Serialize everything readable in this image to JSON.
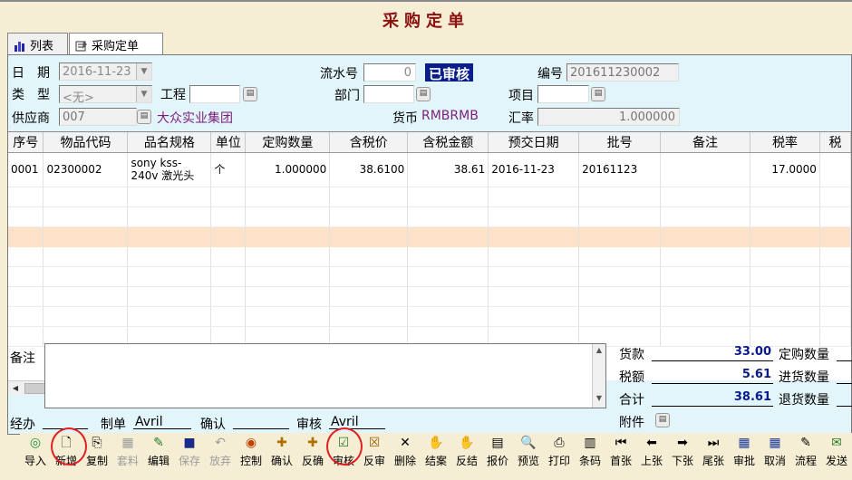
{
  "window": {
    "title": "采购定单"
  },
  "tabs": [
    {
      "label": "列表",
      "icon": "chart-icon"
    },
    {
      "label": "采购定单",
      "icon": "form-icon"
    }
  ],
  "header": {
    "date_label": "日　期",
    "date_value": "2016-11-23",
    "serial_label": "流水号",
    "serial_value": "0",
    "status": "已审核",
    "number_label": "编号",
    "number_value": "201611230002",
    "type_label": "类　型",
    "type_value": "<无>",
    "project_label": "工程",
    "project_value": "",
    "dept_label": "部门",
    "dept_value": "",
    "item_label": "项目",
    "item_value": "",
    "supplier_label": "供应商",
    "supplier_code": "007",
    "supplier_name": "大众实业集团",
    "currency_label": "货币",
    "currency_value": "RMBRMB",
    "rate_label": "汇率",
    "rate_value": "1.000000"
  },
  "grid": {
    "columns": [
      "序号",
      "物品代码",
      "品名规格",
      "单位",
      "定购数量",
      "含税价",
      "含税金额",
      "预交日期",
      "批号",
      "备注",
      "税率",
      "税"
    ],
    "rows": [
      [
        "0001",
        "02300002",
        "sony kss-240v 激光头",
        "个",
        "1.000000",
        "38.6100",
        "38.61",
        "2016-11-23",
        "20161123",
        "",
        "17.0000",
        ""
      ]
    ]
  },
  "notes": {
    "label": "备注",
    "value": ""
  },
  "summary": {
    "goods_label": "货款",
    "goods_value": "33.00",
    "tax_label": "税额",
    "tax_value": "5.61",
    "total_label": "合计",
    "total_value": "38.61",
    "attach_label": "附件",
    "order_qty_label": "定购数量",
    "in_qty_label": "进货数量",
    "return_qty_label": "退货数量"
  },
  "footer": {
    "handler_label": "经办",
    "handler_value": "",
    "maker_label": "制单",
    "maker_value": "Avril",
    "confirm_label": "确认",
    "confirm_value": "",
    "auditor_label": "审核",
    "auditor_value": "Avril"
  },
  "toolbar": [
    {
      "label": "导入",
      "icon": "import-icon",
      "enabled": true
    },
    {
      "label": "新增",
      "icon": "new-document-icon",
      "enabled": true
    },
    {
      "label": "复制",
      "icon": "copy-icon",
      "enabled": true
    },
    {
      "label": "套料",
      "icon": "material-icon",
      "enabled": false
    },
    {
      "label": "编辑",
      "icon": "edit-icon",
      "enabled": true
    },
    {
      "label": "保存",
      "icon": "save-icon",
      "enabled": false
    },
    {
      "label": "放弃",
      "icon": "undo-icon",
      "enabled": false
    },
    {
      "label": "控制",
      "icon": "control-icon",
      "enabled": true
    },
    {
      "label": "确认",
      "icon": "confirm-icon",
      "enabled": true
    },
    {
      "label": "反确",
      "icon": "unconfirm-icon",
      "enabled": true
    },
    {
      "label": "审核",
      "icon": "audit-icon",
      "enabled": true
    },
    {
      "label": "反审",
      "icon": "unaudit-icon",
      "enabled": true
    },
    {
      "label": "删除",
      "icon": "delete-icon",
      "enabled": true
    },
    {
      "label": "结案",
      "icon": "close-case-icon",
      "enabled": true
    },
    {
      "label": "反结",
      "icon": "reopen-case-icon",
      "enabled": true
    },
    {
      "label": "报价",
      "icon": "quote-icon",
      "enabled": true
    },
    {
      "label": "预览",
      "icon": "preview-icon",
      "enabled": true
    },
    {
      "label": "打印",
      "icon": "print-icon",
      "enabled": true
    },
    {
      "label": "条码",
      "icon": "barcode-icon",
      "enabled": true
    },
    {
      "label": "首张",
      "icon": "first-record-icon",
      "enabled": true
    },
    {
      "label": "上张",
      "icon": "previous-record-icon",
      "enabled": true
    },
    {
      "label": "下张",
      "icon": "next-record-icon",
      "enabled": true
    },
    {
      "label": "尾张",
      "icon": "last-record-icon",
      "enabled": true
    },
    {
      "label": "审批",
      "icon": "approve-icon",
      "enabled": true
    },
    {
      "label": "取消",
      "icon": "cancel-icon",
      "enabled": true
    },
    {
      "label": "流程",
      "icon": "workflow-icon",
      "enabled": true
    },
    {
      "label": "发送",
      "icon": "send-icon",
      "enabled": true
    }
  ],
  "annotations": {
    "highlight_color": "#e02020",
    "highlighted_buttons": [
      "新增",
      "审核"
    ]
  }
}
